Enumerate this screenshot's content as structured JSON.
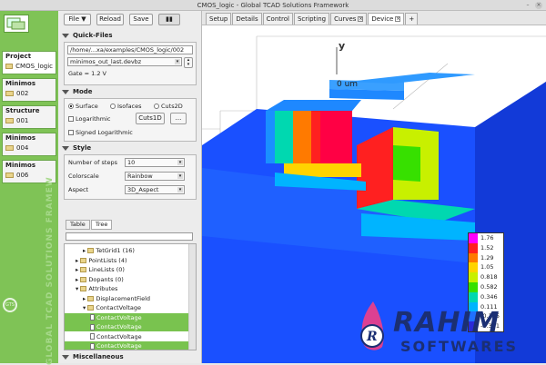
{
  "window": {
    "title": "CMOS_logic - Global TCAD Solutions Framework",
    "minimize": "–",
    "close": "×"
  },
  "nav": {
    "project": {
      "title": "Project",
      "value": "CMOS_logic"
    },
    "cards": [
      {
        "title": "Minimos",
        "value": "002"
      },
      {
        "title": "Structure",
        "value": "001"
      },
      {
        "title": "Minimos",
        "value": "004"
      },
      {
        "title": "Minimos",
        "value": "006"
      }
    ],
    "logo_badge": "GTS",
    "vertical_text": "GLOBAL TCAD SOLUTIONS FRAMEW"
  },
  "toolbar": {
    "file": "File ▼",
    "reload": "Reload",
    "save": "Save"
  },
  "quickfiles": {
    "title": "Quick-Files",
    "path": "/home/...xa/examples/CMOS_logic/002",
    "file": "minimos_out_last.devbz",
    "gate": "Gate = 1.2 V"
  },
  "mode": {
    "title": "Mode",
    "surface": "Surface",
    "isofaces": "Isofaces",
    "cuts2d": "Cuts2D",
    "logarithmic": "Logarithmic",
    "cuts1d": "Cuts1D",
    "ellipsis": "...",
    "signed_log": "Signed Logarithmic"
  },
  "style": {
    "title": "Style",
    "steps_label": "Number of steps",
    "steps_value": "10",
    "colorscale_label": "Colorscale",
    "colorscale_value": "Rainbow",
    "aspect_label": "Aspect",
    "aspect_value": "3D_Aspect"
  },
  "lowertabs": [
    "Table",
    "Tree"
  ],
  "tree": [
    {
      "label": "TetGrid1 (16)",
      "indent": 2,
      "exp": "▸",
      "hl": false,
      "file": false
    },
    {
      "label": "PointLists (4)",
      "indent": 1,
      "exp": "▸",
      "hl": false,
      "file": false
    },
    {
      "label": "LineLists (0)",
      "indent": 1,
      "exp": "▸",
      "hl": false,
      "file": false
    },
    {
      "label": "Dopants (0)",
      "indent": 1,
      "exp": "▸",
      "hl": false,
      "file": false
    },
    {
      "label": "Attributes",
      "indent": 1,
      "exp": "▾",
      "hl": false,
      "file": false
    },
    {
      "label": "DisplacementField",
      "indent": 2,
      "exp": "▸",
      "hl": false,
      "file": false
    },
    {
      "label": "ContactVoltage",
      "indent": 2,
      "exp": "▾",
      "hl": false,
      "file": false
    },
    {
      "label": "ContactVoltage",
      "indent": 3,
      "exp": "",
      "hl": true,
      "file": true
    },
    {
      "label": "ContactVoltage",
      "indent": 3,
      "exp": "",
      "hl": true,
      "file": true
    },
    {
      "label": "ContactVoltage",
      "indent": 3,
      "exp": "",
      "hl": false,
      "file": true
    },
    {
      "label": "ContactVoltage",
      "indent": 3,
      "exp": "",
      "hl": true,
      "file": true
    }
  ],
  "misc": {
    "title": "Miscellaneous"
  },
  "maintabs": [
    {
      "label": "Setup",
      "close": false,
      "active": false
    },
    {
      "label": "Details",
      "close": false,
      "active": false
    },
    {
      "label": "Control",
      "close": false,
      "active": false
    },
    {
      "label": "Scripting",
      "close": false,
      "active": false
    },
    {
      "label": "Curves",
      "close": true,
      "active": false
    },
    {
      "label": "Device",
      "close": true,
      "active": true
    },
    {
      "label": "+",
      "close": false,
      "active": false
    }
  ],
  "viewport": {
    "axis_y": "y",
    "axis_unit": "0  um"
  },
  "legend": {
    "values": [
      "1.76",
      "1.52",
      "1.29",
      "1.05",
      "0.818",
      "0.582",
      "0.346",
      "0.111",
      "-0.125",
      "-0.361"
    ],
    "colors": [
      "#ff00ff",
      "#ff2020",
      "#ff7a00",
      "#ffd400",
      "#c8f000",
      "#37e000",
      "#00d8b0",
      "#00b4ff",
      "#2070ff",
      "#2a2ad8"
    ]
  },
  "watermark": {
    "line1": "RAHIM",
    "line2": "SOFTWARES"
  },
  "colors": {
    "nav_green": "#7fc356",
    "highlight": "#79c34f",
    "device_blue": "#1460ff"
  }
}
